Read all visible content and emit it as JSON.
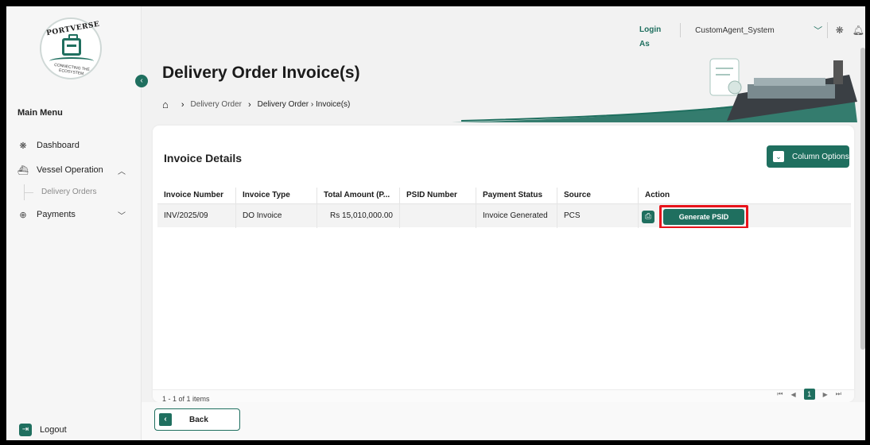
{
  "brand": {
    "logo_top": "PORTVERSE",
    "logo_bottom": "CONNECTING THE ECOSYSTEM"
  },
  "sidebar": {
    "menu_title": "Main Menu",
    "items": [
      {
        "label": "Dashboard",
        "icon": "dashboard-icon"
      },
      {
        "label": "Vessel Operation",
        "icon": "ship-icon",
        "expanded": true
      },
      {
        "label": "Payments",
        "icon": "payments-icon",
        "expanded": false
      }
    ],
    "sub_items": [
      {
        "label": "Delivery Orders"
      }
    ],
    "logout_label": "Logout"
  },
  "topbar": {
    "login_as_label": "Login As",
    "user": "CustomAgent_System"
  },
  "page": {
    "title": "Delivery Order Invoice(s)",
    "breadcrumb": [
      "Delivery Order",
      "Delivery Order › Invoice(s)"
    ]
  },
  "card": {
    "title": "Invoice Details",
    "column_options_label": "Column Options"
  },
  "table": {
    "columns": [
      "Invoice Number",
      "Invoice Type",
      "Total Amount (P...",
      "PSID Number",
      "Payment Status",
      "Source",
      "Action"
    ],
    "rows": [
      {
        "invoice_number": "INV/2025/09",
        "invoice_type": "DO Invoice",
        "total_amount": "Rs 15,010,000.00",
        "psid_number": "",
        "payment_status": "Invoice Generated",
        "source": "PCS",
        "action_label": "Generate PSID"
      }
    ]
  },
  "pagination": {
    "items_text": "1 - 1 of 1 items",
    "current_page": "1"
  },
  "bottom": {
    "back_label": "Back"
  },
  "colors": {
    "primary": "#1f6f5f",
    "highlight": "#e8131b"
  }
}
